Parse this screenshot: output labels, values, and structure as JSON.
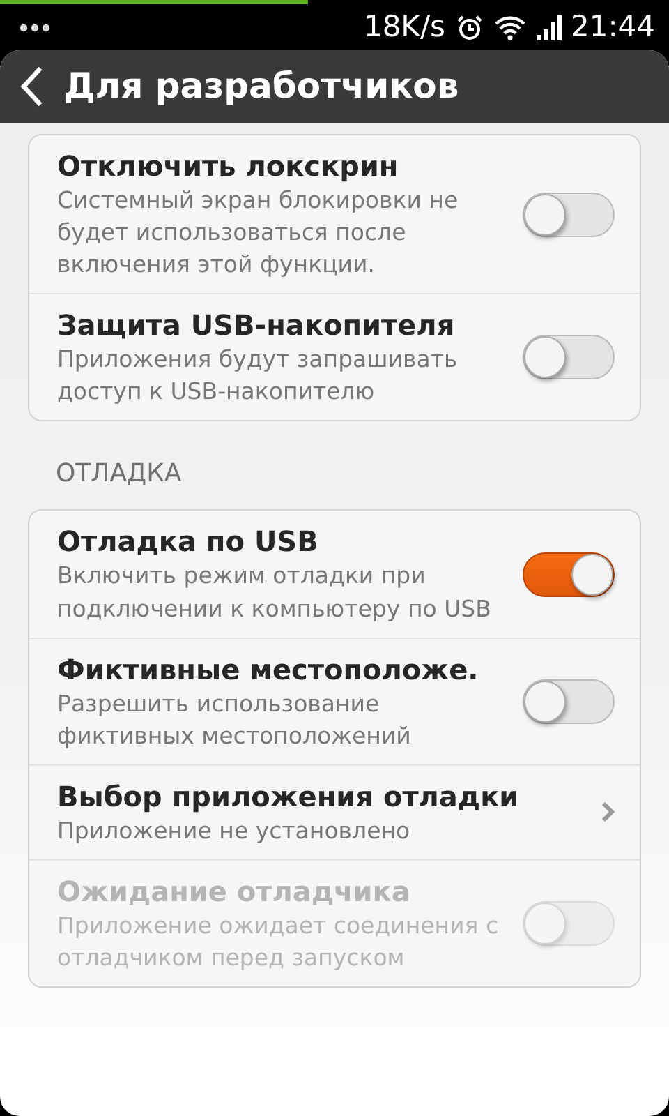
{
  "top_progress": {
    "level": 0.46
  },
  "status_bar": {
    "speed": "18K/s",
    "time": "21:44"
  },
  "header": {
    "title": "Для разработчиков"
  },
  "sections": [
    {
      "items": [
        {
          "kind": "toggle",
          "title": "Отключить локскрин",
          "subtitle": "Системный экран блокировки не будет использоваться после включения этой функции.",
          "on": false,
          "disabled": false
        },
        {
          "kind": "toggle",
          "title": "Защита USB-накопителя",
          "subtitle": "Приложения будут запрашивать доступ к USB-накопителю",
          "on": false,
          "disabled": false
        }
      ]
    },
    {
      "heading": "ОТЛАДКА",
      "items": [
        {
          "kind": "toggle",
          "title": "Отладка по USB",
          "subtitle": "Включить режим отладки при подключении к компьютеру по USB",
          "on": true,
          "disabled": false
        },
        {
          "kind": "toggle",
          "title": "Фиктивные местоположе.",
          "subtitle": "Разрешить использование фиктивных местоположений",
          "on": false,
          "disabled": false
        },
        {
          "kind": "link",
          "title": "Выбор приложения отладки",
          "subtitle": "Приложение не установлено",
          "disabled": false
        },
        {
          "kind": "toggle",
          "title": "Ожидание отладчика",
          "subtitle": "Приложение ожидает соединения с отладчиком перед запуском",
          "on": false,
          "disabled": true
        }
      ]
    }
  ]
}
